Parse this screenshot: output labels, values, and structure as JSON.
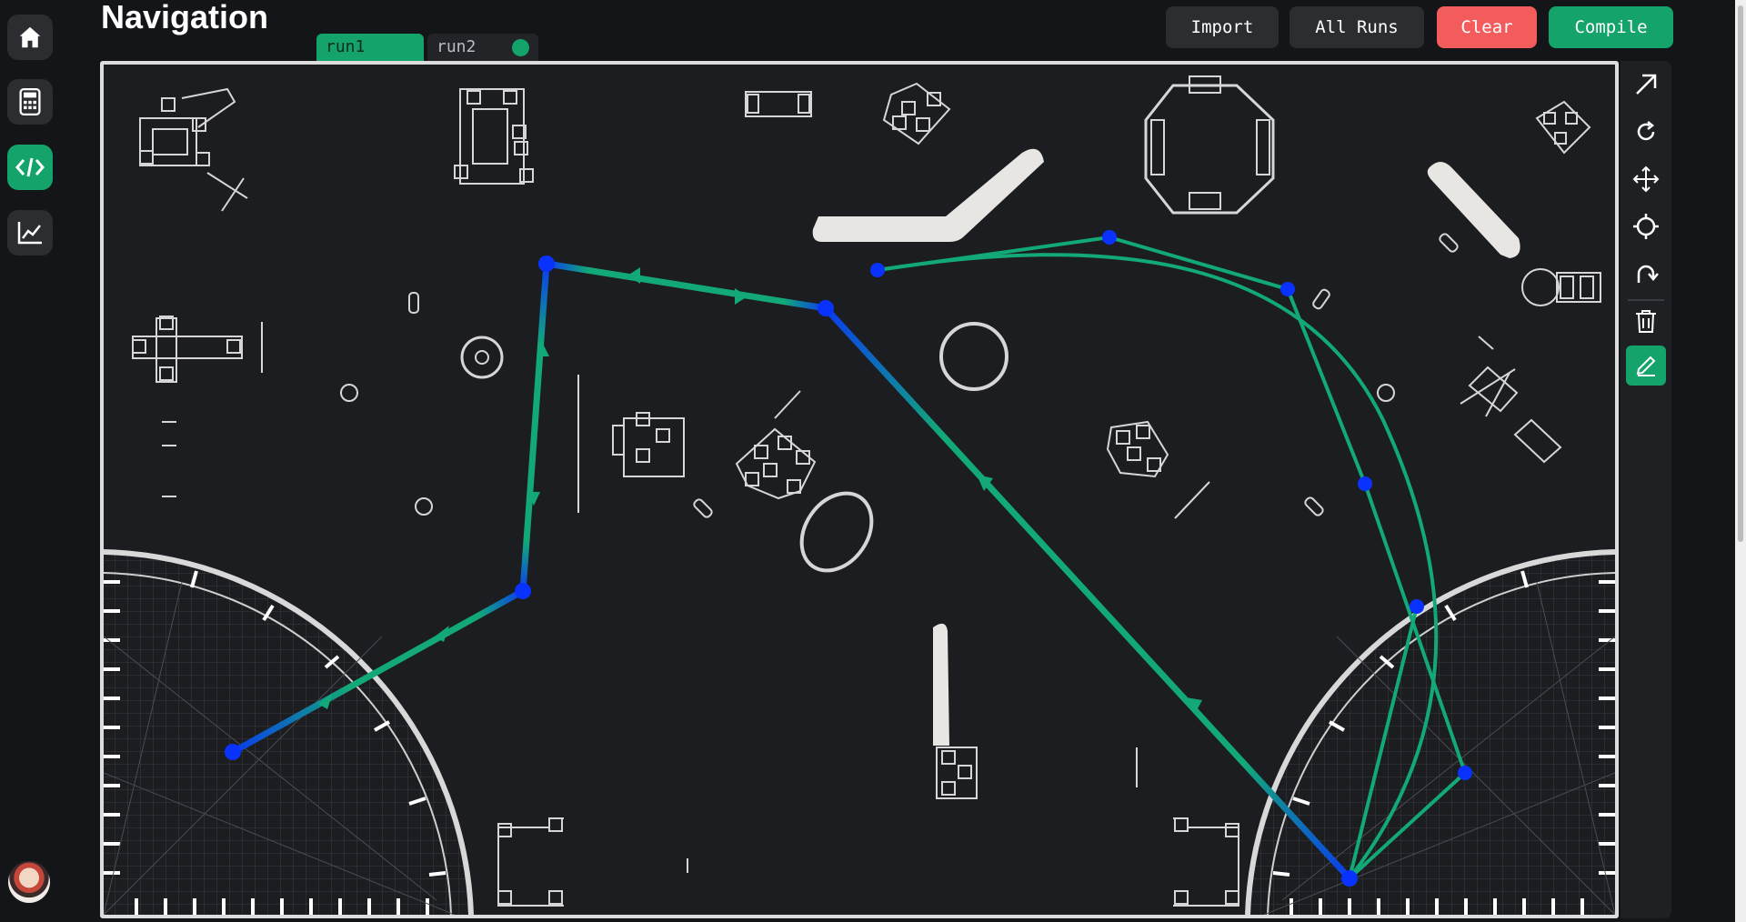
{
  "header": {
    "title": "Navigation",
    "tabs": [
      {
        "label": "run1",
        "active": true
      },
      {
        "label": "run2",
        "active": false
      }
    ],
    "buttons": {
      "import": "Import",
      "all_runs": "All Runs",
      "clear": "Clear",
      "compile": "Compile"
    }
  },
  "sidebar": {
    "items": [
      {
        "name": "home",
        "icon": "home-icon",
        "active": false
      },
      {
        "name": "calculator",
        "icon": "calculator-icon",
        "active": false
      },
      {
        "name": "code",
        "icon": "code-icon",
        "active": true
      },
      {
        "name": "chart",
        "icon": "line-chart-icon",
        "active": false
      }
    ],
    "avatar": "user-avatar"
  },
  "toolbar": {
    "tools": [
      {
        "name": "arrow",
        "icon": "arrow-up-right-icon",
        "active": false
      },
      {
        "name": "rotate",
        "icon": "rotate-icon",
        "active": false
      },
      {
        "name": "move",
        "icon": "move-icon",
        "active": false
      },
      {
        "name": "target",
        "icon": "crosshair-icon",
        "active": false
      },
      {
        "name": "redo",
        "icon": "redo-arrow-icon",
        "active": false
      },
      {
        "name": "delete",
        "icon": "trash-icon",
        "active": false
      },
      {
        "name": "draw",
        "icon": "pencil-icon",
        "active": true
      }
    ]
  },
  "colors": {
    "accent": "#14a36b",
    "danger": "#f25c5c",
    "path_green": "#12a878",
    "path_blue": "#0a3cf0",
    "waypoint": "#0a32ff",
    "field_bg": "#1c1d21"
  }
}
